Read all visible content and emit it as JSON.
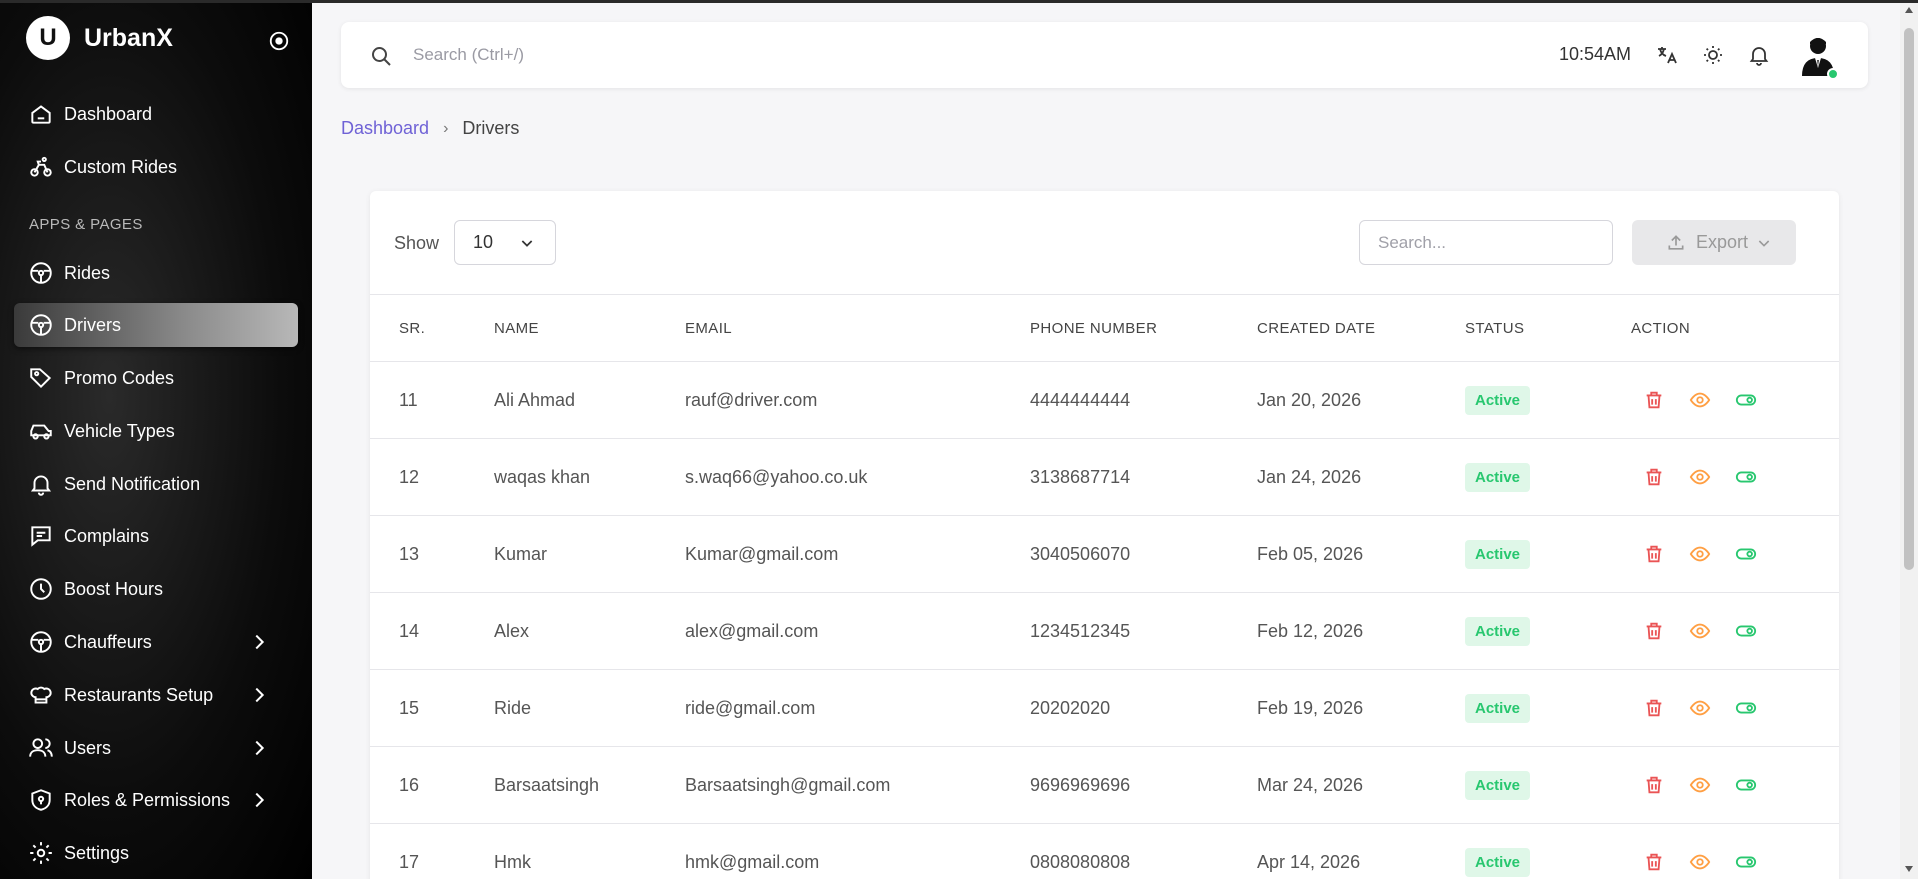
{
  "brand": {
    "logo_letter": "U",
    "name": "UrbanX"
  },
  "sidebar": {
    "section_label": "APPS & PAGES",
    "items": [
      {
        "label": "Dashboard",
        "icon": "home-icon"
      },
      {
        "label": "Custom Rides",
        "icon": "bike-icon"
      },
      {
        "label": "Rides",
        "icon": "steering-wheel-icon"
      },
      {
        "label": "Drivers",
        "icon": "steering-wheel-icon",
        "active": true
      },
      {
        "label": "Promo Codes",
        "icon": "tag-icon"
      },
      {
        "label": "Vehicle Types",
        "icon": "car-icon"
      },
      {
        "label": "Send Notification",
        "icon": "bell-icon"
      },
      {
        "label": "Complains",
        "icon": "message-icon"
      },
      {
        "label": "Boost Hours",
        "icon": "clock-icon"
      },
      {
        "label": "Chauffeurs",
        "icon": "steering-wheel-icon",
        "has_submenu": true
      },
      {
        "label": "Restaurants Setup",
        "icon": "chef-hat-icon",
        "has_submenu": true
      },
      {
        "label": "Users",
        "icon": "users-icon",
        "has_submenu": true
      },
      {
        "label": "Roles & Permissions",
        "icon": "shield-icon",
        "has_submenu": true
      },
      {
        "label": "Settings",
        "icon": "gear-icon"
      }
    ]
  },
  "header": {
    "search_placeholder": "Search (Ctrl+/)",
    "time": "10:54AM"
  },
  "breadcrumb": {
    "parent": "Dashboard",
    "current": "Drivers"
  },
  "table_controls": {
    "show_label": "Show",
    "page_size": "10",
    "search_placeholder": "Search...",
    "export_label": "Export"
  },
  "table": {
    "headers": [
      "SR.",
      "NAME",
      "EMAIL",
      "PHONE NUMBER",
      "CREATED DATE",
      "STATUS",
      "ACTION"
    ],
    "rows": [
      {
        "sr": "11",
        "name": "Ali Ahmad",
        "email": "rauf@driver.com",
        "phone": "4444444444",
        "date": "Jan 20, 2026",
        "status": "Active"
      },
      {
        "sr": "12",
        "name": "waqas khan",
        "email": "s.waq66@yahoo.co.uk",
        "phone": "3138687714",
        "date": "Jan 24, 2026",
        "status": "Active"
      },
      {
        "sr": "13",
        "name": "Kumar",
        "email": "Kumar@gmail.com",
        "phone": "3040506070",
        "date": "Feb 05, 2026",
        "status": "Active"
      },
      {
        "sr": "14",
        "name": "Alex",
        "email": "alex@gmail.com",
        "phone": "1234512345",
        "date": "Feb 12, 2026",
        "status": "Active"
      },
      {
        "sr": "15",
        "name": "Ride",
        "email": "ride@gmail.com",
        "phone": "20202020",
        "date": "Feb 19, 2026",
        "status": "Active"
      },
      {
        "sr": "16",
        "name": "Barsaatsingh",
        "email": "Barsaatsingh@gmail.com",
        "phone": "9696969696",
        "date": "Mar 24, 2026",
        "status": "Active"
      },
      {
        "sr": "17",
        "name": "Hmk",
        "email": "hmk@gmail.com",
        "phone": "0808080808",
        "date": "Apr 14, 2026",
        "status": "Active"
      }
    ]
  },
  "colors": {
    "accent": "#6f62d6",
    "status_active_bg": "#dff7e8",
    "status_active_text": "#28c76f",
    "delete_icon": "#ea5455",
    "view_icon": "#ff9f43",
    "toggle_icon": "#28c76f"
  }
}
